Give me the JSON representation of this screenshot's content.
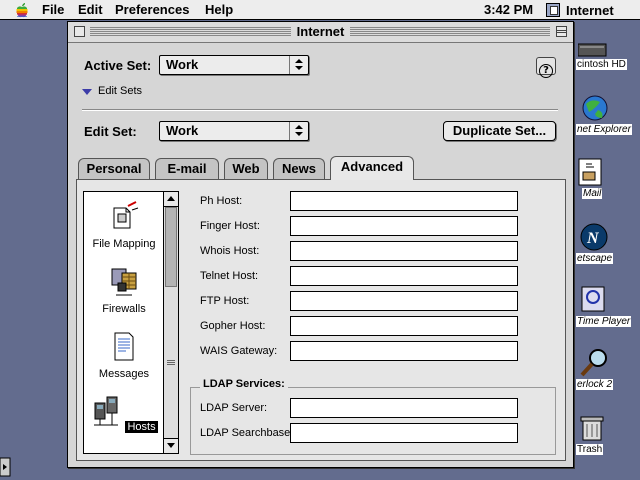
{
  "menubar": {
    "items": [
      "File",
      "Edit",
      "Preferences",
      "Help"
    ],
    "clock": "3:42 PM",
    "app_name": "Internet"
  },
  "desktop": {
    "icons": [
      {
        "label": "cintosh HD",
        "icon": "hard-disk-icon"
      },
      {
        "label": "net Explorer",
        "icon": "internet-explorer-icon"
      },
      {
        "label": "Mail",
        "icon": "mail-icon"
      },
      {
        "label": "etscape",
        "icon": "netscape-icon"
      },
      {
        "label": "Time Player",
        "icon": "quicktime-player-icon"
      },
      {
        "label": "erlock 2",
        "icon": "sherlock-icon"
      },
      {
        "label": "Trash",
        "icon": "trash-icon"
      }
    ]
  },
  "window": {
    "title": "Internet",
    "active_set_label": "Active Set:",
    "active_set_value": "Work",
    "edit_sets_label": "Edit Sets",
    "edit_set_label": "Edit Set:",
    "edit_set_value": "Work",
    "duplicate_button": "Duplicate Set...",
    "help_icon": "?",
    "tabs": [
      "Personal",
      "E-mail",
      "Web",
      "News",
      "Advanced"
    ],
    "active_tab": "Advanced",
    "categories": [
      {
        "label": "File Mapping",
        "icon": "file-mapping-icon",
        "selected": false
      },
      {
        "label": "Firewalls",
        "icon": "firewalls-icon",
        "selected": false
      },
      {
        "label": "Messages",
        "icon": "messages-icon",
        "selected": false
      },
      {
        "label": "Hosts",
        "icon": "hosts-icon",
        "selected": true
      }
    ],
    "fields": [
      {
        "label": "Ph Host:",
        "value": ""
      },
      {
        "label": "Finger Host:",
        "value": ""
      },
      {
        "label": "Whois Host:",
        "value": ""
      },
      {
        "label": "Telnet Host:",
        "value": ""
      },
      {
        "label": "FTP Host:",
        "value": ""
      },
      {
        "label": "Gopher Host:",
        "value": ""
      },
      {
        "label": "WAIS Gateway:",
        "value": ""
      }
    ],
    "ldap": {
      "title": "LDAP Services:",
      "server_label": "LDAP Server:",
      "server_value": "",
      "searchbase_label": "LDAP Searchbase:",
      "searchbase_value": ""
    }
  },
  "colors": {
    "desktop": "#636c8e",
    "window": "#d6d6d6",
    "panel": "#e6e6e6",
    "disclosure": "#3c3ca8"
  }
}
